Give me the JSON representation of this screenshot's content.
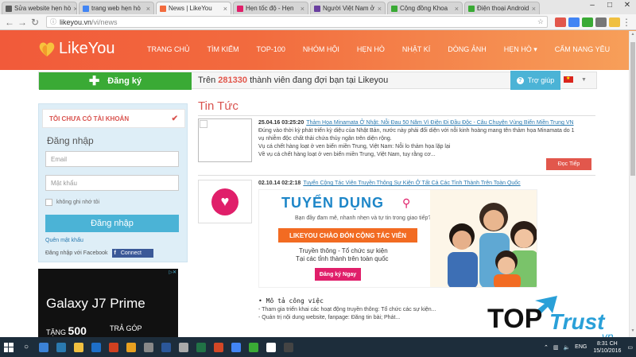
{
  "browser": {
    "tabs": [
      {
        "label": "Sửa website hẹn hò",
        "color": "#5b5b5b",
        "active": false
      },
      {
        "label": "trang web hẹn hò",
        "color": "#4285f4",
        "active": false
      },
      {
        "label": "News | LikeYou",
        "color": "#f26b3e",
        "active": true
      },
      {
        "label": "Hẹn tốc độ - Hẹn",
        "color": "#e01f6a",
        "active": false
      },
      {
        "label": "Người Việt Nam ở",
        "color": "#6a3fa0",
        "active": false
      },
      {
        "label": "Cộng đồng Khoa",
        "color": "#3aaa35",
        "active": false
      },
      {
        "label": "Điện thoại Android",
        "color": "#3aaa35",
        "active": false
      }
    ],
    "url_domain": "likeyou.vn",
    "url_path": "/vi/news",
    "window_controls": [
      "–",
      "□",
      "✕"
    ]
  },
  "header": {
    "logo_text": "LikeYou",
    "nav": [
      "TRANG CHỦ",
      "TÌM KIẾM",
      "TOP-100",
      "NHÓM HỘI",
      "HẸN HÒ",
      "NHẬT KÍ",
      "DÒNG ẢNH",
      "HẸN HÒ ▾",
      "CẨM NANG YÊU"
    ]
  },
  "subbar": {
    "register_label": "Đăng ký",
    "member_prefix": "Trên",
    "member_count": "281330",
    "member_suffix": "thành viên đang đợi bạn tại Likeyou",
    "help_label": "Trợ giúp"
  },
  "login": {
    "no_account": "TÔI CHƯA CÓ TÀI KHOẢN",
    "title": "Đăng nhập",
    "email_placeholder": "Email",
    "password_placeholder": "Mật khẩu",
    "remember_label": "không ghi nhớ tôi",
    "login_button": "Đăng nhập",
    "forgot": "Quên mật khẩu",
    "fb_prefix": "Đăng nhập với Facebook",
    "fb_button": "Connect"
  },
  "ad": {
    "headline": "Galaxy J7 Prime",
    "tang": "TẶNG",
    "tang_value": "500",
    "tra_gop": "TRẢ GÓP"
  },
  "content": {
    "title": "Tin Tức",
    "articles": [
      {
        "date": "25.04.16 03:25:20",
        "title": "Thảm Họa Minamata Ở Nhật: Nỗi Đau 50 Năm Vì Điện Đi Đầu Độc - Câu Chuyện Vùng Biển Miền Trung VN",
        "lines": [
          "Đúng vào thời kỳ phát triển kỳ diệu của Nhật Bản, nước này phải đối diện với nỗi kinh hoàng mang tên thảm họa Minamata do 1",
          "vụ nhiễm độc chất thải chứa thủy ngân trên diện rộng.",
          "Vụ cá chết hàng loạt ở ven biển miền Trung, Việt Nam: Nỗi lo thảm họa lặp lại",
          "Về vụ cá chết hàng loạt ở ven biển miền Trung, Việt Nam, tuy rằng cơ..."
        ],
        "read_more": "Đọc Tiếp"
      },
      {
        "date": "02.10.14 02:2:18",
        "title": "Tuyển Cộng Tác Viên Truyền Thông Sự Kiện Ở Tất Cả Các Tỉnh Thành Trên Toàn Quốc"
      }
    ],
    "banner": {
      "headline": "TUYỂN DỤNG",
      "line1": "Bạn đầy đam mê, nhanh nhẹn và tự tin trong giao tiếp?",
      "orange": "LIKEYOU CHÀO ĐÓN CỘNG TÁC VIÊN",
      "line2": "Truyền thông - Tổ chức sự kiện",
      "line3": "Tại các tỉnh thành trên toàn quốc",
      "cta": "Đăng ký Ngay"
    },
    "mota_title": "• Mô tả công việc",
    "mota_items": [
      "- Tham gia triển khai các hoạt động truyền thông: Tổ chức các sự kiện...",
      "- Quản trị nội dung website, fanpage: Đăng tin bài; Phát..."
    ]
  },
  "watermark": {
    "top": "TOP",
    "trust": "Trust",
    "vn": ".vn"
  },
  "taskbar": {
    "apps": [
      "#3b82d6",
      "#2a7ab0",
      "#f0c040",
      "#1e6fc8",
      "#d04020",
      "#e8a020",
      "#888888",
      "#2b579a",
      "#aaaaaa",
      "#217346",
      "#d24726",
      "#4285f4",
      "#3aaa35",
      "#ffffff",
      "#444444"
    ],
    "lang": "ENG",
    "time": "8:31 CH",
    "date": "15/10/2016"
  }
}
